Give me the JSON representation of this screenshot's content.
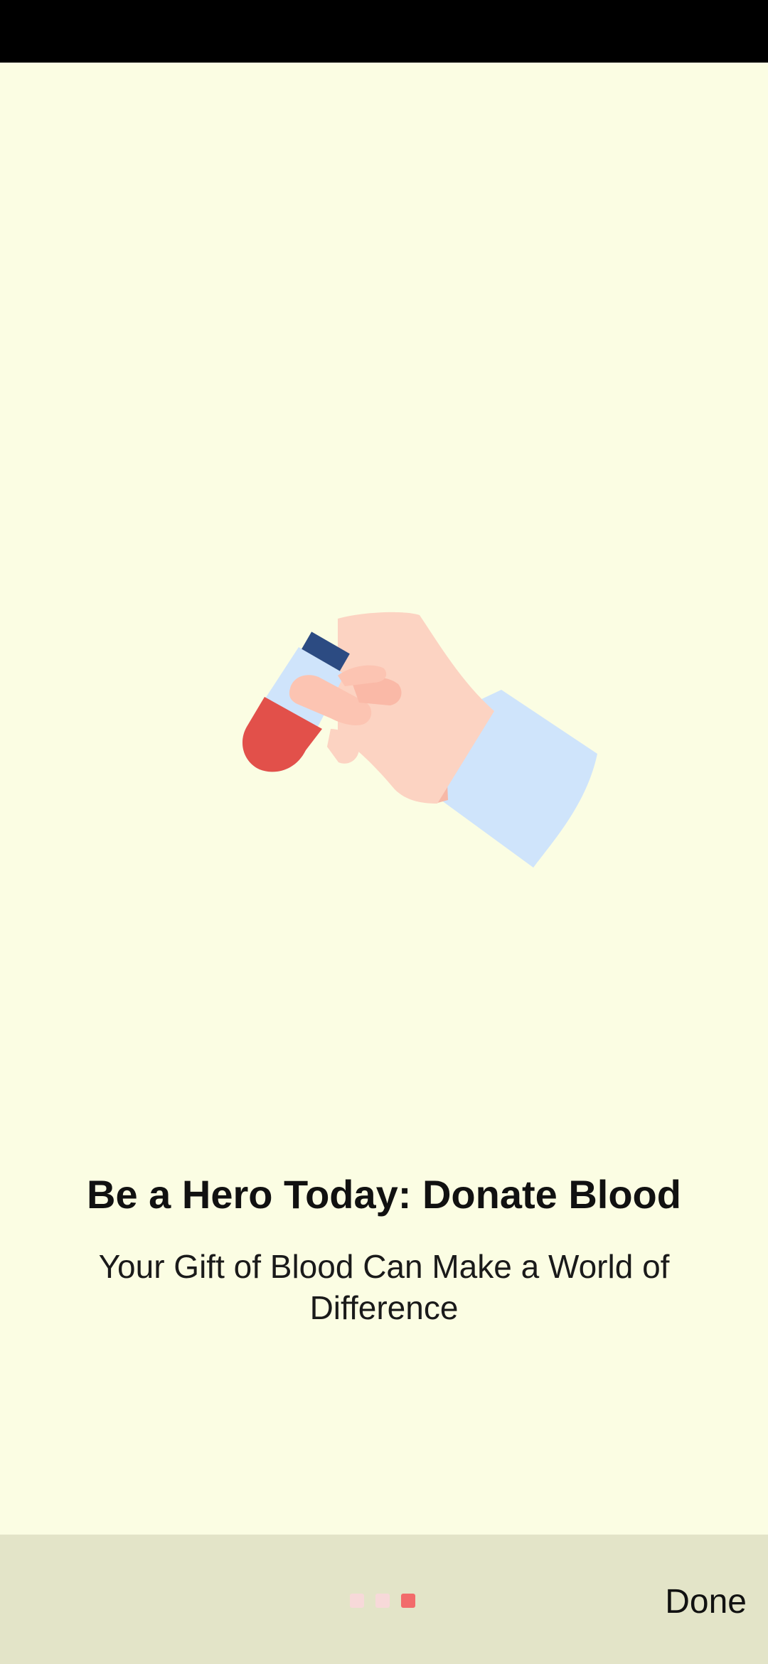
{
  "onboarding": {
    "title": "Be a Hero Today: Donate Blood",
    "subtitle": "Your Gift of Blood Can Make a World of Difference",
    "illustration_icon": "hand-holding-blood-tube-icon"
  },
  "footer": {
    "done_label": "Done",
    "page_indicator": {
      "total_pages": 3,
      "current_page": 3,
      "active_color": "#f26b6b",
      "inactive_color": "#f7d9d9"
    }
  },
  "colors": {
    "background": "#fbfde3",
    "bottom_bar": "#e3e4c8",
    "status_bar": "#000000"
  }
}
